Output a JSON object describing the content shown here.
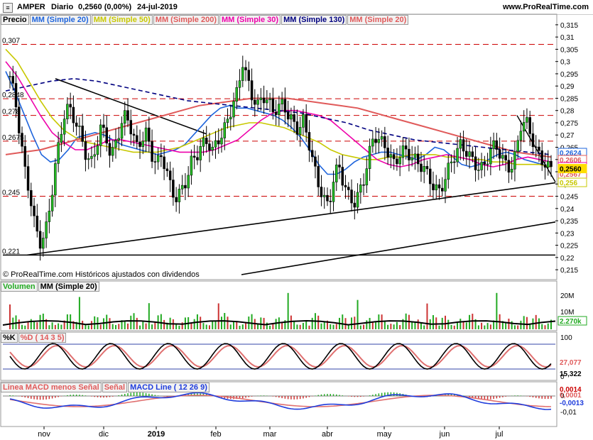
{
  "header": {
    "symbol": "AMPER",
    "period": "Diario",
    "last": "0,2560 (0,00%)",
    "date": "24-jul-2019",
    "site": "www.ProRealTime.com"
  },
  "price_panel": {
    "legend": [
      "Precio",
      "MM (Simple 20)",
      "MM (Simple 50)",
      "MM (Simple 200)",
      "MM (Simple 30)",
      "MM (Simple 130)",
      "MM (Simple 20)"
    ],
    "legend_colors": [
      "#000000",
      "#1e64dc",
      "#c8c800",
      "#e05a5a",
      "#ee00aa",
      "#000080",
      "#e05a5a"
    ],
    "footer": "© ProRealTime.com Históricos ajustados con dividendos",
    "y_ticks": [
      "0,315",
      "0,31",
      "0,305",
      "0,3",
      "0,295",
      "0,29",
      "0,285",
      "0,28",
      "0,275",
      "0,27",
      "0,265",
      "0,26",
      "0,255",
      "0,25",
      "0,245",
      "0,24",
      "0,235",
      "0,23",
      "0,225",
      "0,22",
      "0,215"
    ],
    "level_labels": [
      "0,307",
      "0,2848",
      "0,278",
      "0,2675",
      "0,245",
      "0,221"
    ],
    "right_labels": [
      {
        "text": "0,2624",
        "color": "#1e64dc"
      },
      {
        "text": "0,2606",
        "color": "#e05a5a"
      },
      {
        "text": "0,2587",
        "color": "#ee00aa"
      },
      {
        "text": "0,2567",
        "color": "#e05a5a"
      },
      {
        "text": "0,256",
        "color": "#c8c800"
      },
      {
        "text": "0,2560",
        "color": "#ffdd00"
      }
    ]
  },
  "volume_panel": {
    "legend": [
      "Volumen",
      "MM (Simple 20)"
    ],
    "y_ticks": [
      "20M",
      "10M"
    ],
    "current": "2.270k"
  },
  "stoch_panel": {
    "legend": [
      "%K",
      "%D ( 14 3 5)"
    ],
    "y_ticks": [
      "100",
      "0"
    ],
    "values": [
      "27,077",
      "15,322"
    ]
  },
  "macd_panel": {
    "legend": [
      "Linea MACD menos Señal",
      "Señal",
      "MACD Line ( 12 26 9)"
    ],
    "y_ticks": [
      "0",
      "-0,01"
    ],
    "values": [
      "0,0014",
      "0,0001",
      "-0,0013"
    ]
  },
  "x_axis": {
    "labels": [
      "nov",
      "dic",
      "2019",
      "feb",
      "mar",
      "abr",
      "may",
      "jun",
      "jul"
    ]
  },
  "chart_data": {
    "type": "candlestick",
    "ylim": [
      0.213,
      0.317
    ],
    "horizontal_levels": [
      0.307,
      0.2848,
      0.278,
      0.2675,
      0.245
    ],
    "support_level": 0.221,
    "close_path": [
      0.294,
      0.285,
      0.27,
      0.255,
      0.245,
      0.232,
      0.226,
      0.23,
      0.242,
      0.258,
      0.27,
      0.281,
      0.28,
      0.275,
      0.27,
      0.262,
      0.258,
      0.265,
      0.273,
      0.27,
      0.26,
      0.268,
      0.274,
      0.279,
      0.272,
      0.265,
      0.268,
      0.271,
      0.262,
      0.258,
      0.262,
      0.255,
      0.247,
      0.244,
      0.248,
      0.252,
      0.26,
      0.262,
      0.266,
      0.268,
      0.263,
      0.268,
      0.27,
      0.276,
      0.282,
      0.288,
      0.3,
      0.292,
      0.285,
      0.282,
      0.286,
      0.284,
      0.28,
      0.281,
      0.283,
      0.278,
      0.275,
      0.272,
      0.276,
      0.268,
      0.258,
      0.25,
      0.244,
      0.241,
      0.252,
      0.258,
      0.25,
      0.245,
      0.242,
      0.246,
      0.252,
      0.262,
      0.27,
      0.268,
      0.266,
      0.262,
      0.258,
      0.262,
      0.264,
      0.262,
      0.26,
      0.258,
      0.256,
      0.252,
      0.248,
      0.247,
      0.252,
      0.258,
      0.262,
      0.266,
      0.264,
      0.261,
      0.258,
      0.256,
      0.258,
      0.264,
      0.266,
      0.262,
      0.258,
      0.256,
      0.262,
      0.274,
      0.276,
      0.27,
      0.264,
      0.26,
      0.258,
      0.256
    ],
    "ma_series": [
      {
        "name": "MM (Simple 20)",
        "color": "#1e64dc",
        "values": [
          0.296,
          0.288,
          0.279,
          0.27,
          0.262,
          0.259,
          0.26,
          0.264,
          0.269,
          0.27,
          0.271,
          0.27,
          0.268,
          0.266,
          0.265,
          0.264,
          0.263,
          0.262,
          0.263,
          0.264,
          0.266,
          0.27,
          0.274,
          0.278,
          0.281,
          0.282,
          0.281,
          0.281,
          0.28,
          0.279,
          0.278,
          0.276,
          0.273,
          0.269,
          0.264,
          0.258,
          0.254,
          0.254,
          0.256,
          0.259,
          0.261,
          0.262,
          0.263,
          0.263,
          0.262,
          0.261,
          0.26,
          0.262,
          0.265,
          0.264,
          0.261,
          0.258,
          0.257,
          0.258,
          0.26,
          0.262,
          0.263,
          0.262,
          0.26,
          0.259,
          0.258,
          0.257
        ]
      },
      {
        "name": "MM (Simple 50)",
        "color": "#c8c800",
        "values": [
          0.305,
          0.3,
          0.292,
          0.284,
          0.277,
          0.272,
          0.269,
          0.267,
          0.266,
          0.265,
          0.264,
          0.263,
          0.263,
          0.263,
          0.264,
          0.265,
          0.267,
          0.269,
          0.271,
          0.273,
          0.274,
          0.275,
          0.275,
          0.274,
          0.273,
          0.271,
          0.269,
          0.267,
          0.264,
          0.262,
          0.261,
          0.26,
          0.26,
          0.261,
          0.261,
          0.262,
          0.262,
          0.262,
          0.261,
          0.261,
          0.26,
          0.26,
          0.259,
          0.259,
          0.258,
          0.258,
          0.258,
          0.257
        ]
      },
      {
        "name": "MM (Simple 200)",
        "color": "#e05a5a",
        "values": [
          0.262,
          0.263,
          0.264,
          0.266,
          0.268,
          0.27,
          0.272,
          0.274,
          0.276,
          0.278,
          0.28,
          0.282,
          0.283,
          0.284,
          0.285,
          0.285,
          0.285,
          0.284,
          0.283,
          0.282,
          0.281,
          0.279,
          0.277,
          0.275,
          0.273,
          0.271,
          0.269,
          0.267,
          0.265,
          0.263,
          0.262,
          0.261
        ]
      },
      {
        "name": "MM (Simple 30)",
        "color": "#ee00aa",
        "values": [
          0.3,
          0.294,
          0.286,
          0.278,
          0.271,
          0.267,
          0.264,
          0.264,
          0.266,
          0.268,
          0.268,
          0.267,
          0.266,
          0.265,
          0.264,
          0.263,
          0.263,
          0.263,
          0.264,
          0.266,
          0.268,
          0.272,
          0.276,
          0.279,
          0.28,
          0.28,
          0.279,
          0.278,
          0.276,
          0.272,
          0.268,
          0.264,
          0.26,
          0.258,
          0.257,
          0.258,
          0.26,
          0.261,
          0.262,
          0.261,
          0.26,
          0.258,
          0.257,
          0.258,
          0.26,
          0.261,
          0.26,
          0.259
        ]
      },
      {
        "name": "MM (Simple 130)",
        "color": "#000080",
        "values": [
          0.288,
          0.29,
          0.292,
          0.293,
          0.292,
          0.29,
          0.288,
          0.286,
          0.284,
          0.283,
          0.282,
          0.281,
          0.28,
          0.279,
          0.277,
          0.275,
          0.272,
          0.27,
          0.268,
          0.267,
          0.266,
          0.265,
          0.264,
          0.263,
          0.262
        ]
      }
    ]
  }
}
